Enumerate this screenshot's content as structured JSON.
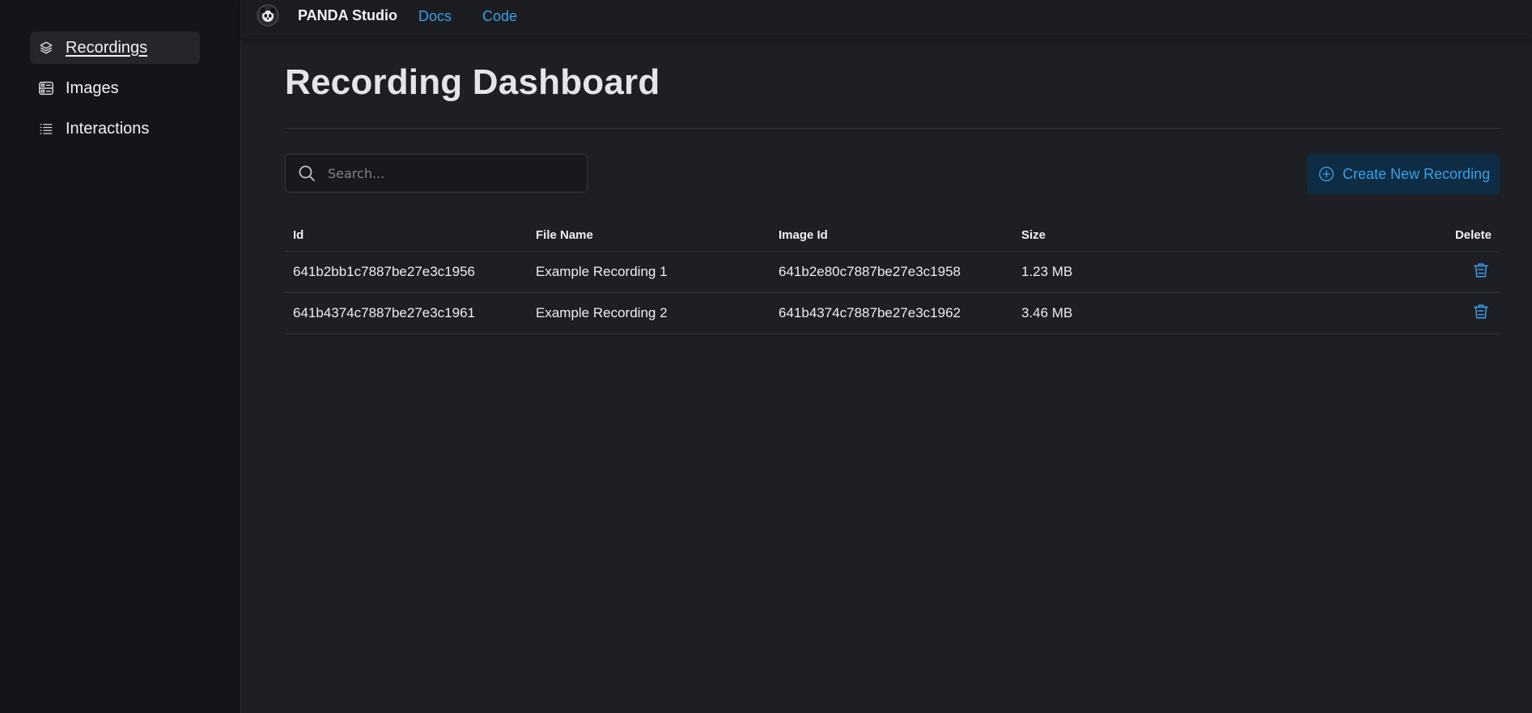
{
  "sidebar": {
    "items": [
      {
        "label": "Recordings",
        "icon": "layers-icon",
        "active": true
      },
      {
        "label": "Images",
        "icon": "image-list-icon",
        "active": false
      },
      {
        "label": "Interactions",
        "icon": "list-icon",
        "active": false
      }
    ]
  },
  "topbar": {
    "brand": "PANDA Studio",
    "links": [
      "Docs",
      "Code"
    ]
  },
  "main": {
    "title": "Recording Dashboard",
    "search": {
      "placeholder": "Search...",
      "value": ""
    },
    "create_button": "Create New Recording"
  },
  "table": {
    "headers": {
      "id": "Id",
      "file_name": "File Name",
      "image_id": "Image Id",
      "size": "Size",
      "delete": "Delete"
    },
    "rows": [
      {
        "id": "641b2bb1c7887be27e3c1956",
        "file_name": "Example Recording 1",
        "image_id": "641b2e80c7887be27e3c1958",
        "size": "1.23 MB"
      },
      {
        "id": "641b4374c7887be27e3c1961",
        "file_name": "Example Recording 2",
        "image_id": "641b4374c7887be27e3c1962",
        "size": "3.46 MB"
      }
    ]
  },
  "colors": {
    "accent": "#3aa0e8",
    "background": "#1e1f24",
    "sidebar": "#141519"
  }
}
